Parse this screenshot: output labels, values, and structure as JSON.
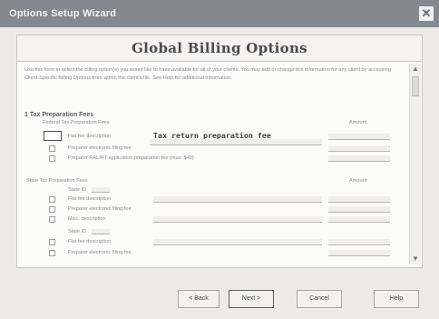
{
  "window": {
    "title": "Options Setup Wizard",
    "close_glyph": "✕"
  },
  "heading": "Global Billing Options",
  "intro_text": "Use this form to select the billing option(s) you would like to have available for all of your clients. You may add or change this information for any client by accessing Client-Specific Billing Options from within the client's file. See Help for additional information.",
  "section1": {
    "title": "1  Tax Preparation Fees",
    "federal_label": "Federal Tax Preparation Fees",
    "amount_label": "Amount",
    "rows": [
      {
        "label": "Flat fee description",
        "typed_value": "Tax return preparation fee"
      },
      {
        "label": "Preparer electronic filing fee"
      },
      {
        "label": "Preparer RAL/RT application preparation fee (max: $40)"
      }
    ],
    "state_label": "State Tax Preparation Fees",
    "state_amount_label": "Amount",
    "state_blocks": [
      {
        "state_id_label": "State ID",
        "flat_fee": "Flat fee description",
        "efile": "Preparer electronic filing fee",
        "misc": "Misc. description"
      },
      {
        "state_id_label": "State ID",
        "flat_fee": "Flat fee description",
        "efile": "Preparer electronic filing fee"
      }
    ]
  },
  "scrollbar": {
    "up": "▲",
    "down": "▼"
  },
  "buttons": {
    "back": "< Back",
    "next": "Next >",
    "cancel": "Cancel",
    "help": "Help"
  }
}
